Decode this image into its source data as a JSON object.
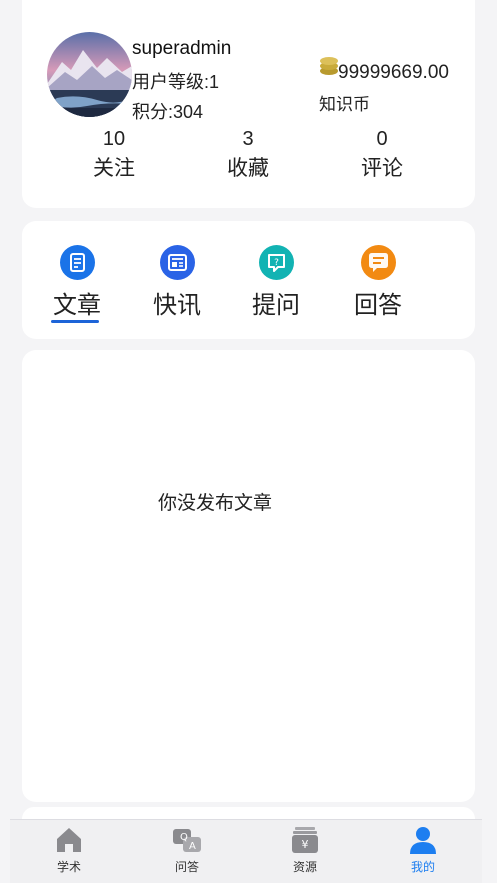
{
  "profile": {
    "username": "superadmin",
    "level": "用户等级:1",
    "points": "积分:304",
    "coin_amount": "99999669.00",
    "coin_label": "知识币",
    "stats": [
      {
        "value": "10",
        "label": "关注"
      },
      {
        "value": "3",
        "label": "收藏"
      },
      {
        "value": "0",
        "label": "评论"
      }
    ]
  },
  "tabs": [
    {
      "label": "文章",
      "icon": "article-icon",
      "color": "#1a73e8",
      "active": true
    },
    {
      "label": "快讯",
      "icon": "news-icon",
      "color": "#2a63e6",
      "active": false
    },
    {
      "label": "提问",
      "icon": "question-icon",
      "color": "#12b3b3",
      "active": false
    },
    {
      "label": "回答",
      "icon": "answer-icon",
      "color": "#f28a12",
      "active": false
    }
  ],
  "content": {
    "empty_message": "你没发布文章"
  },
  "bottom_nav": [
    {
      "label": "学术",
      "icon": "home-icon",
      "active": false
    },
    {
      "label": "问答",
      "icon": "qa-icon",
      "active": false
    },
    {
      "label": "资源",
      "icon": "resource-icon",
      "active": false
    },
    {
      "label": "我的",
      "icon": "user-icon",
      "active": true
    }
  ],
  "colors": {
    "accent": "#1d64d8",
    "nav_active": "#1d7ef0",
    "nav_inactive_icon": "#8a8a8e",
    "background": "#f4f4f6"
  }
}
